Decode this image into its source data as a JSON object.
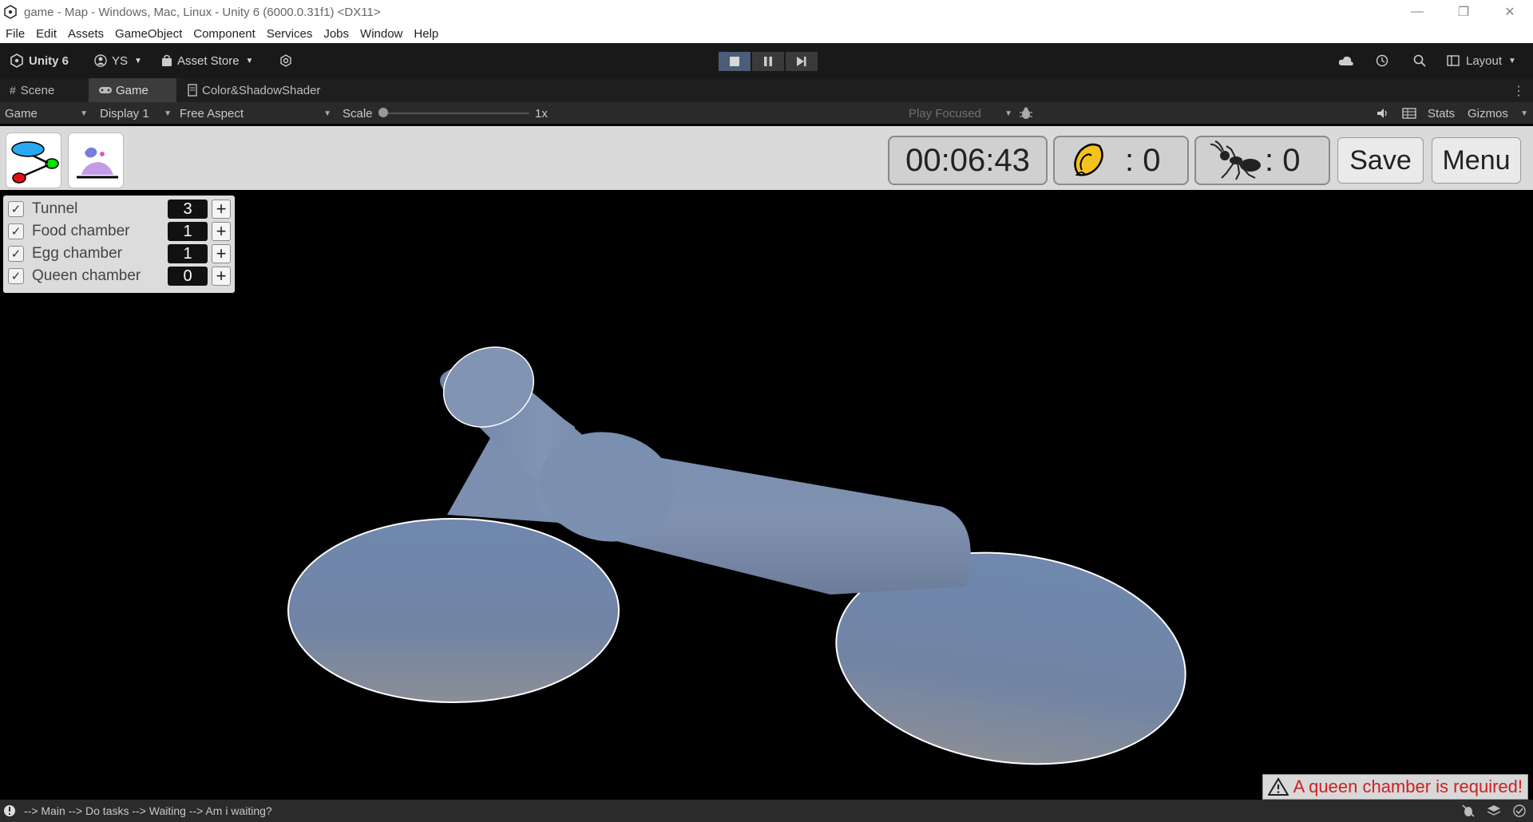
{
  "window": {
    "title": "game - Map - Windows, Mac, Linux - Unity 6 (6000.0.31f1) <DX11>",
    "controls": [
      "—",
      "❐",
      "✕"
    ]
  },
  "menu": [
    "File",
    "Edit",
    "Assets",
    "GameObject",
    "Component",
    "Services",
    "Jobs",
    "Window",
    "Help"
  ],
  "toolbar": {
    "unity_label": "Unity 6",
    "account_label": "YS",
    "asset_store_label": "Asset Store",
    "layout_label": "Layout"
  },
  "tabs": [
    {
      "label": "Scene",
      "icon": "grid-icon"
    },
    {
      "label": "Game",
      "icon": "gamepad-icon"
    },
    {
      "label": "Color&ShadowShader",
      "icon": "shader-icon"
    }
  ],
  "gamebar": {
    "view_label": "Game",
    "display_label": "Display 1",
    "aspect_label": "Free Aspect",
    "scale_label": "Scale",
    "scale_value": "1x",
    "play_mode_label": "Play Focused",
    "stats_label": "Stats",
    "gizmos_label": "Gizmos"
  },
  "hud": {
    "timer": "00:06:43",
    "food_count": ": 0",
    "ant_count": ": 0",
    "save_label": "Save",
    "menu_label": "Menu"
  },
  "rooms": [
    {
      "name": "Tunnel",
      "count": "3",
      "checked": true
    },
    {
      "name": "Food chamber",
      "count": "1",
      "checked": true
    },
    {
      "name": "Egg chamber",
      "count": "1",
      "checked": true
    },
    {
      "name": "Queen chamber",
      "count": "0",
      "checked": true
    }
  ],
  "warning": "A queen chamber is required!",
  "status": {
    "message": "--> Main --> Do tasks --> Waiting --> Am i waiting?"
  },
  "colors": {
    "tunnel": "#7389ad",
    "warning_text": "#cc2222",
    "play_active": "#4b5d78"
  }
}
